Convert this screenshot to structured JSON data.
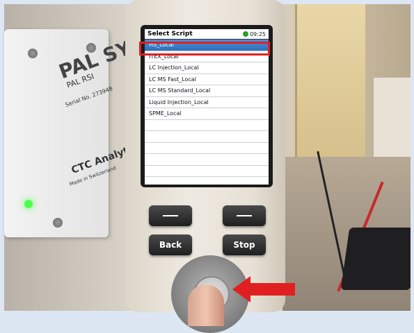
{
  "device": {
    "screen_title": "Select Script",
    "clock": "09:25",
    "selected_index": 0,
    "scripts": [
      "HS_Local",
      "ITEX_Local",
      "LC Injection_Local",
      "LC MS Fast_Local",
      "LC MS Standard_Local",
      "Liquid Injection_Local",
      "SPME_Local",
      "",
      "",
      "",
      "",
      "",
      ""
    ],
    "buttons": {
      "softkey_left": "—",
      "softkey_right": "—",
      "back": "Back",
      "stop": "Stop"
    }
  },
  "pal_box": {
    "logo": "PAL SYSTEM",
    "model": "PAL RSI",
    "serial": "Serial No. 273948",
    "brand": "CTC Analytics",
    "made_in": "Made in Switzerland"
  },
  "annotation": {
    "highlight_color": "#e02020",
    "arrow_color": "#e02020"
  }
}
